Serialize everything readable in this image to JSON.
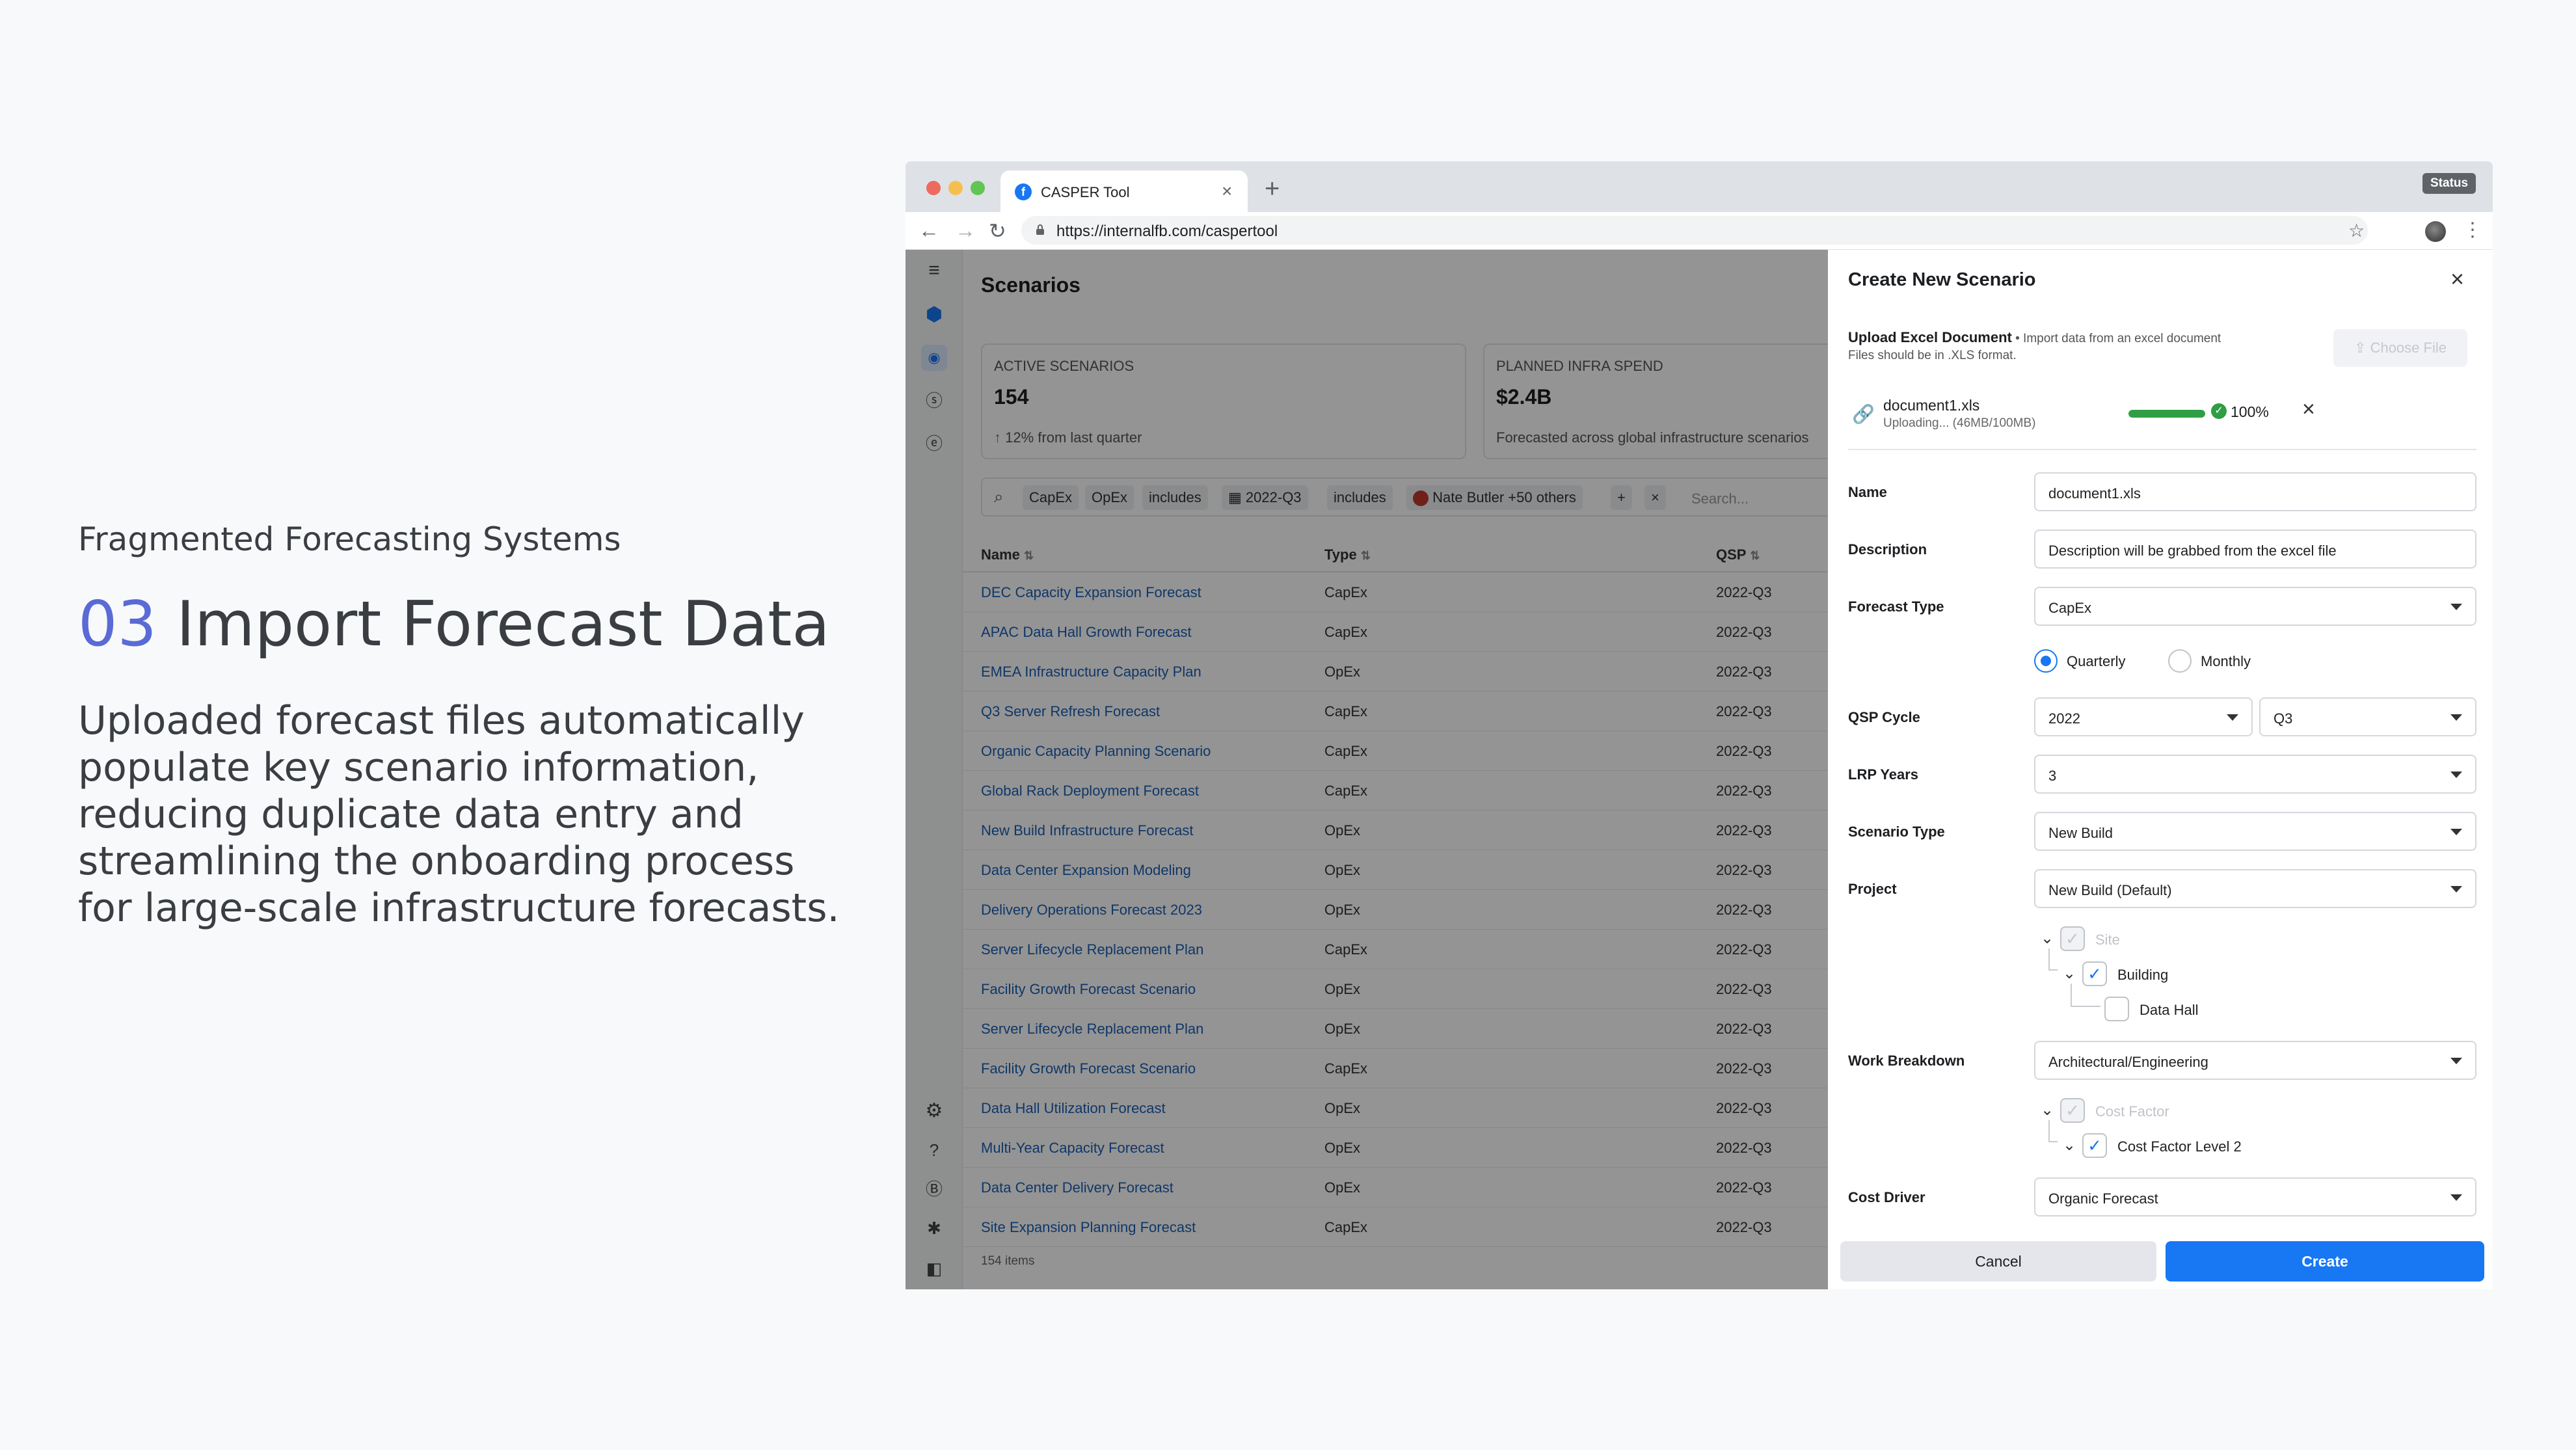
{
  "slide": {
    "subtitle": "Fragmented Forecasting Systems",
    "number": "03",
    "title": "Import Forecast Data",
    "description": "Uploaded forecast files automatically populate key scenario information, reducing duplicate data entry and streamlining the onboarding process for large-scale infrastructure forecasts."
  },
  "browser": {
    "tab_title": "CASPER Tool",
    "url": "https://internalfb.com/caspertool",
    "status_label": "Status"
  },
  "app": {
    "page_title": "Scenarios",
    "cards": [
      {
        "label": "Active Scenarios",
        "value": "154",
        "footer": "12% from last quarter"
      },
      {
        "label": "Planned Infra Spend",
        "value": "$2.4B",
        "footer": "Forecasted across global infrastructure scenarios"
      }
    ],
    "filters": [
      "CapEx",
      "OpEx",
      "includes",
      "2022-Q3",
      "includes",
      "Nate Butler +50 others"
    ],
    "search_placeholder": "Search...",
    "columns": [
      "Name",
      "Type",
      "QSP"
    ],
    "rows": [
      {
        "name": "DEC Capacity Expansion Forecast",
        "type": "CapEx",
        "qsp": "2022-Q3"
      },
      {
        "name": "APAC Data Hall Growth Forecast",
        "type": "CapEx",
        "qsp": "2022-Q3"
      },
      {
        "name": "EMEA Infrastructure Capacity Plan",
        "type": "OpEx",
        "qsp": "2022-Q3"
      },
      {
        "name": "Q3 Server Refresh Forecast",
        "type": "CapEx",
        "qsp": "2022-Q3"
      },
      {
        "name": "Organic Capacity Planning Scenario",
        "type": "CapEx",
        "qsp": "2022-Q3"
      },
      {
        "name": "Global Rack Deployment Forecast",
        "type": "CapEx",
        "qsp": "2022-Q3"
      },
      {
        "name": "New Build Infrastructure Forecast",
        "type": "OpEx",
        "qsp": "2022-Q3"
      },
      {
        "name": "Data Center Expansion Modeling",
        "type": "OpEx",
        "qsp": "2022-Q3"
      },
      {
        "name": "Delivery Operations Forecast 2023",
        "type": "OpEx",
        "qsp": "2022-Q3"
      },
      {
        "name": "Server Lifecycle Replacement Plan",
        "type": "CapEx",
        "qsp": "2022-Q3"
      },
      {
        "name": "Facility Growth Forecast Scenario",
        "type": "OpEx",
        "qsp": "2022-Q3"
      },
      {
        "name": "Server Lifecycle Replacement Plan",
        "type": "OpEx",
        "qsp": "2022-Q3"
      },
      {
        "name": "Facility Growth Forecast Scenario",
        "type": "CapEx",
        "qsp": "2022-Q3"
      },
      {
        "name": "Data Hall Utilization Forecast",
        "type": "OpEx",
        "qsp": "2022-Q3"
      },
      {
        "name": "Multi-Year Capacity Forecast",
        "type": "OpEx",
        "qsp": "2022-Q3"
      },
      {
        "name": "Data Center Delivery Forecast",
        "type": "OpEx",
        "qsp": "2022-Q3"
      },
      {
        "name": "Site Expansion Planning Forecast",
        "type": "CapEx",
        "qsp": "2022-Q3"
      }
    ],
    "items_count": "154 items"
  },
  "panel": {
    "title": "Create New Scenario",
    "upload_title": "Upload Excel Document",
    "upload_hint": " • Import data from an excel document",
    "upload_sub": "Files should be in .XLS format.",
    "choose_file": "Choose File",
    "file_name": "document1.xls",
    "file_status": "Uploading... (46MB/100MB)",
    "progress_pct": "100%",
    "progress_value": 1.0,
    "name_label": "Name",
    "name_value": "document1.xls",
    "description_label": "Description",
    "description_value": "Description will be grabbed from the excel file",
    "forecast_type_label": "Forecast Type",
    "forecast_type_value": "CapEx",
    "quarterly": "Quarterly",
    "monthly": "Monthly",
    "qsp_label": "QSP Cycle",
    "qsp_year": "2022",
    "qsp_quarter": "Q3",
    "lrp_label": "LRP Years",
    "lrp_value": "3",
    "scenario_type_label": "Scenario Type",
    "scenario_type_value": "New Build",
    "project_label": "Project",
    "project_value": "New Build (Default)",
    "project_tree": [
      "Site",
      "Building",
      "Data Hall"
    ],
    "work_label": "Work Breakdown",
    "work_value": "Architectural/Engineering",
    "work_tree": [
      "Cost Factor",
      "Cost Factor Level 2"
    ],
    "cost_driver_label": "Cost Driver",
    "cost_driver_value": "Organic Forecast",
    "cancel": "Cancel",
    "create": "Create"
  },
  "colors": {
    "accent": "#1877f2",
    "success": "#2f9e44",
    "slide_number": "#5a6ad6"
  }
}
